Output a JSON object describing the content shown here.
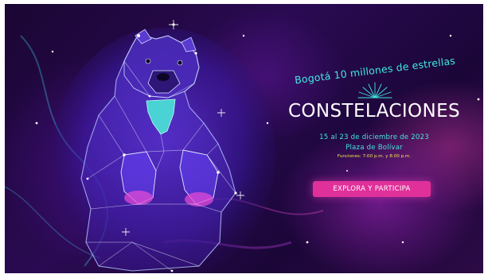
{
  "banner": {
    "tagline": "Bogotá 10 millones de estrellas",
    "title": "CONSTELACIONES",
    "dates": "15 al 23 de diciembre de 2023",
    "place": "Plaza de Bolívar",
    "showtimes": "Funciones: 7:00 p.m. y 8:00 p.m.",
    "cta_label": "EXPLORA Y PARTICIPA",
    "illustration": "spectacled-bear-constellation",
    "colors": {
      "accent_cyan": "#41e8e0",
      "accent_pink": "#e0309a",
      "accent_yellow": "#f3e24a",
      "background": "#1a0633"
    }
  }
}
